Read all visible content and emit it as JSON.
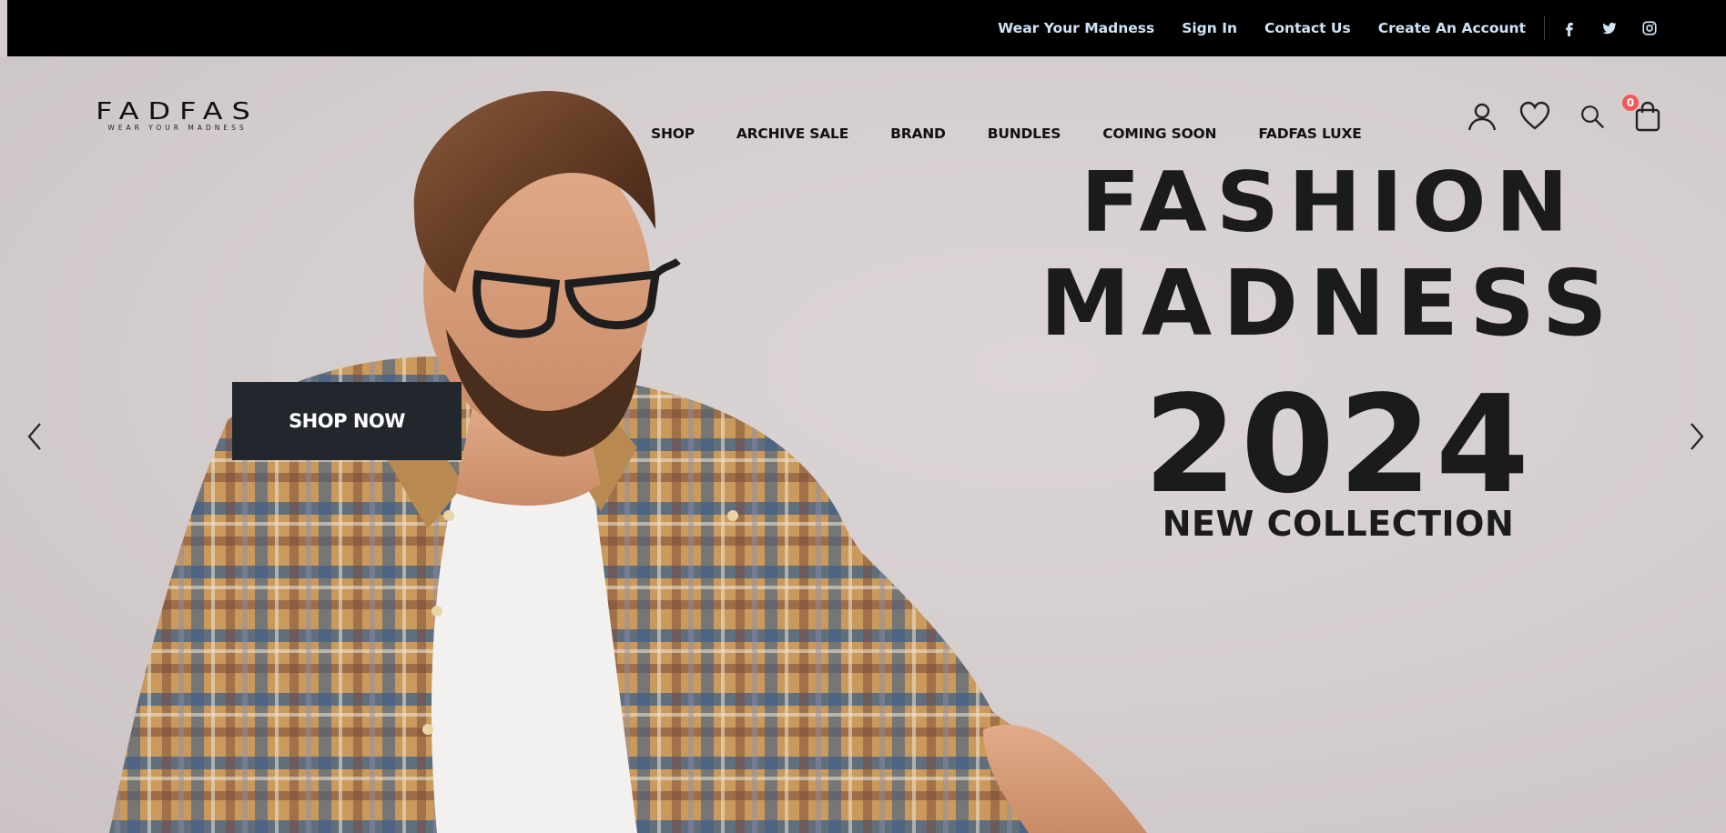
{
  "topbar": {
    "links": [
      "Wear Your Madness",
      "Sign In",
      "Contact Us",
      "Create An Account"
    ],
    "socials": [
      "facebook-icon",
      "twitter-icon",
      "instagram-icon"
    ],
    "link_color": "#cfe4f7",
    "background": "#000000"
  },
  "logo": {
    "main": "FADFAS",
    "tagline": "WEAR YOUR MADNESS"
  },
  "nav": {
    "items": [
      "SHOP",
      "ARCHIVE SALE",
      "BRAND",
      "BUNDLES",
      "COMING SOON",
      "FADFAS LUXE"
    ]
  },
  "header_icons": {
    "icons": [
      "user-icon",
      "heart-icon",
      "search-icon",
      "shopping-bag-icon"
    ],
    "cart_count": "0",
    "badge_color": "#f25a5a"
  },
  "hero": {
    "line1": "FASHION",
    "line2": "MADNESS",
    "year": "2024",
    "subtitle": "NEW COLLECTION",
    "cta": "SHOP NOW",
    "cta_color": "#22262d",
    "prev": "chevron-left-icon",
    "next": "chevron-right-icon"
  }
}
